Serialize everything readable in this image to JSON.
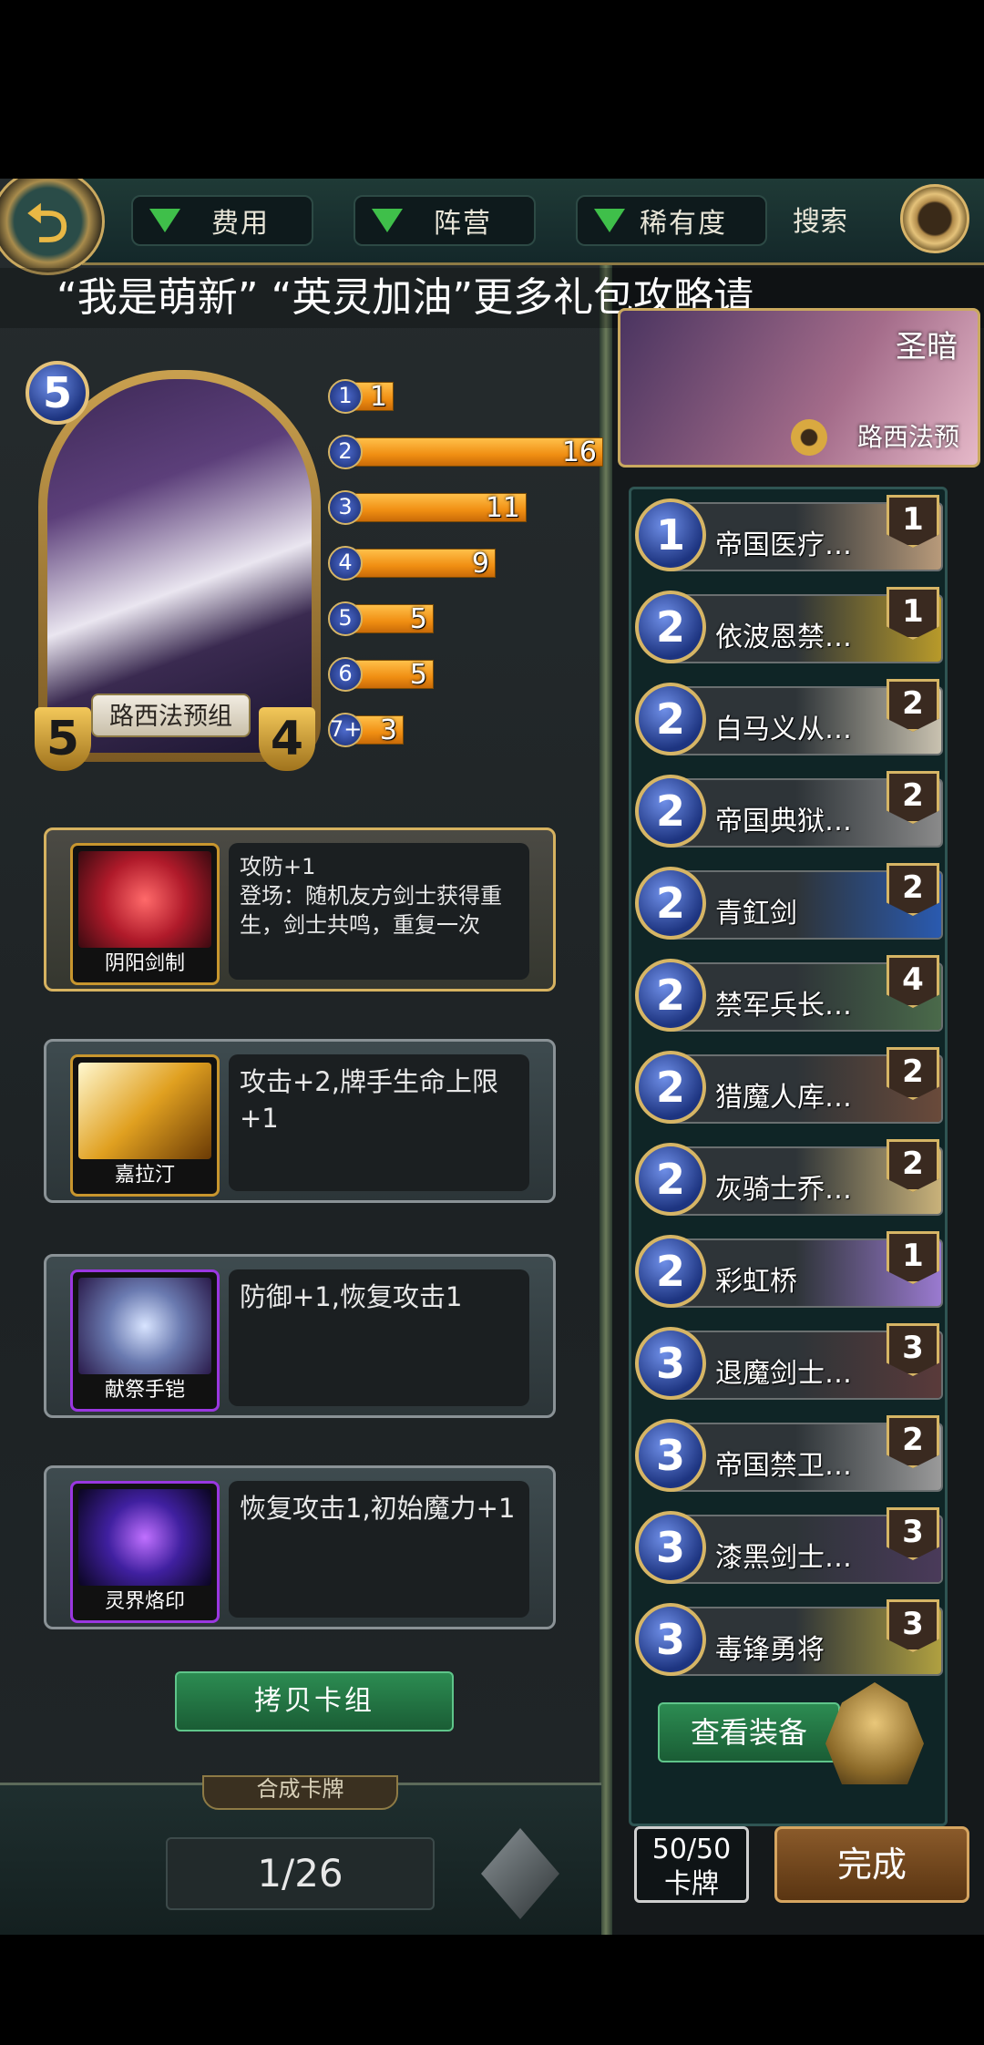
{
  "topbar": {
    "filters": [
      {
        "label": "费用"
      },
      {
        "label": "阵营"
      },
      {
        "label": "稀有度"
      }
    ],
    "search_label": "搜索"
  },
  "marquee_text": "“我是萌新”   “英灵加油”更多礼包攻略请",
  "card": {
    "cost": "5",
    "attack": "5",
    "health": "4",
    "name": "路西法预组"
  },
  "cost_curve": [
    {
      "cost": "1",
      "count": 1
    },
    {
      "cost": "2",
      "count": 16
    },
    {
      "cost": "3",
      "count": 11
    },
    {
      "cost": "4",
      "count": 9
    },
    {
      "cost": "5",
      "count": 5
    },
    {
      "cost": "6",
      "count": 5
    },
    {
      "cost": "7+",
      "count": 3
    }
  ],
  "equipment": [
    {
      "name": "阴阳剑制",
      "desc": "攻防+1\n登场：随机友方剑士获得重生，剑士共鸣，重复一次",
      "color": "#c8962e"
    },
    {
      "name": "嘉拉汀",
      "desc": "攻击+2,牌手生命上限+1",
      "color": "#c8962e"
    },
    {
      "name": "献祭手铠",
      "desc": "防御+1,恢复攻击1",
      "color": "#9a37e0"
    },
    {
      "name": "灵界烙印",
      "desc": "恢复攻击1,初始魔力+1",
      "color": "#9a37e0"
    }
  ],
  "copy_button": "拷贝卡组",
  "synth_tab": "合成卡牌",
  "pagination": "1/26",
  "deck": {
    "faction": "圣暗",
    "name": "路西法预",
    "cards": [
      {
        "cost": "1",
        "name": "帝国医疗…",
        "count": "1",
        "art": "#b89a7a"
      },
      {
        "cost": "2",
        "name": "依波恩禁…",
        "count": "1",
        "art": "#b89a2a"
      },
      {
        "cost": "2",
        "name": "白马义从…",
        "count": "2",
        "art": "#c9c2b0"
      },
      {
        "cost": "2",
        "name": "帝国典狱…",
        "count": "2",
        "art": "#8a8a8a"
      },
      {
        "cost": "2",
        "name": "青釭剑",
        "count": "2",
        "art": "#2a5ab0"
      },
      {
        "cost": "2",
        "name": "禁军兵长…",
        "count": "4",
        "art": "#4a6a4a"
      },
      {
        "cost": "2",
        "name": "猎魔人库…",
        "count": "2",
        "art": "#6a4a3a"
      },
      {
        "cost": "2",
        "name": "灰骑士乔…",
        "count": "2",
        "art": "#c9b27a"
      },
      {
        "cost": "2",
        "name": "彩虹桥",
        "count": "1",
        "art": "#9a7ad0"
      },
      {
        "cost": "3",
        "name": "退魔剑士…",
        "count": "3",
        "art": "#5a3a3a"
      },
      {
        "cost": "3",
        "name": "帝国禁卫…",
        "count": "2",
        "art": "#9a9a9a"
      },
      {
        "cost": "3",
        "name": "漆黑剑士…",
        "count": "3",
        "art": "#4a3a5a"
      },
      {
        "cost": "3",
        "name": "毒锋勇将",
        "count": "3",
        "art": "#b0a040"
      }
    ]
  },
  "view_equip_button": "查看装备",
  "card_count": {
    "value": "50/50",
    "label": "卡牌"
  },
  "done_button": "完成"
}
